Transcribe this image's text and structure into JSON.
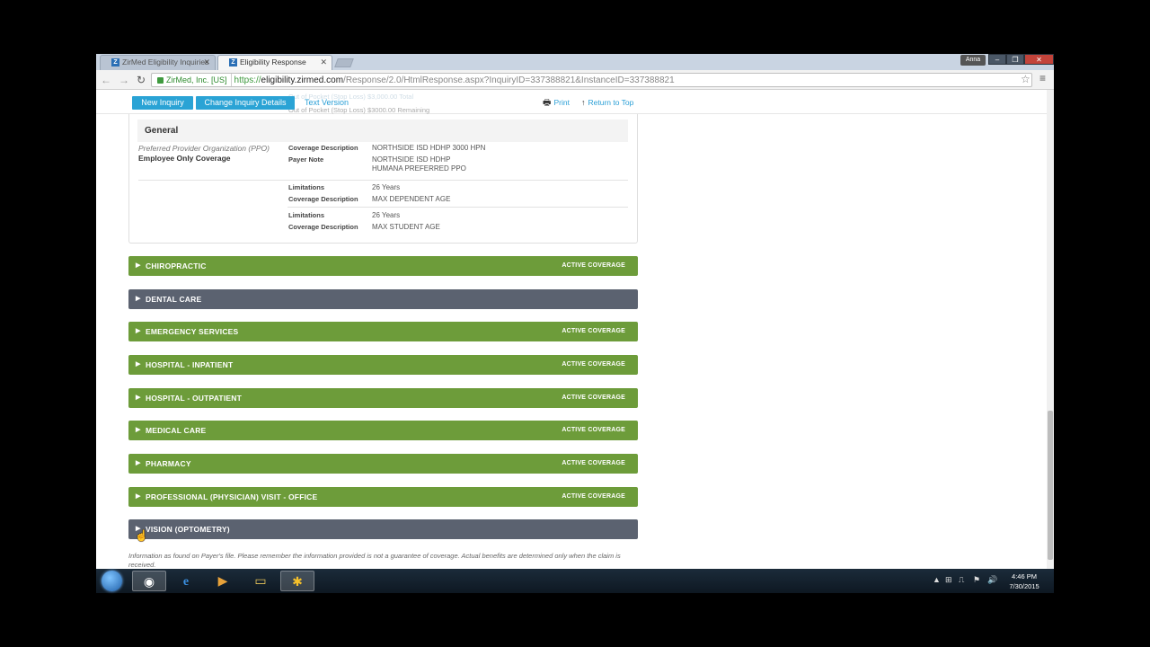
{
  "browser": {
    "tabs": [
      {
        "title": "ZirMed Eligibility Inquiries",
        "active": false
      },
      {
        "title": "Eligibility Response",
        "active": true
      }
    ],
    "user": "Anna",
    "ev_cert": "ZirMed, Inc. [US]",
    "url_scheme": "https://",
    "url_host": "eligibility.zirmed.com",
    "url_path": "/Response/2.0/HtmlResponse.aspx?InquiryID=337388821&InstanceID=337388821"
  },
  "toolbar": {
    "new_inquiry": "New Inquiry",
    "change_details": "Change Inquiry Details",
    "text_version": "Text Version",
    "print": "Print",
    "return_top": "Return to Top",
    "behind_text_1": "Out of Pocket (Stop Loss) $3,000.00 Total",
    "behind_text_2": "Out of Pocket (Stop Loss) $3000.00 Remaining"
  },
  "general": {
    "heading": "General",
    "plan_type": "Preferred Provider Organization (PPO)",
    "coverage_level": "Employee Only Coverage",
    "block1": [
      {
        "label": "Coverage Description",
        "value": "NORTHSIDE ISD HDHP 3000 HPN"
      },
      {
        "label": "Payer Note",
        "value": "NORTHSIDE ISD HDHP",
        "value2": "HUMANA PREFERRED PPO"
      }
    ],
    "block2": [
      {
        "label": "Limitations",
        "value": "26 Years"
      },
      {
        "label": "Coverage Description",
        "value": "MAX DEPENDENT AGE"
      }
    ],
    "block3": [
      {
        "label": "Limitations",
        "value": "26 Years"
      },
      {
        "label": "Coverage Description",
        "value": "MAX STUDENT AGE"
      }
    ]
  },
  "coverages": [
    {
      "name": "CHIROPRACTIC",
      "status": "ACTIVE COVERAGE",
      "color": "#6d9c3a"
    },
    {
      "name": "DENTAL CARE",
      "status": "",
      "color": "#5b6270"
    },
    {
      "name": "EMERGENCY SERVICES",
      "status": "ACTIVE COVERAGE",
      "color": "#6d9c3a"
    },
    {
      "name": "HOSPITAL - INPATIENT",
      "status": "ACTIVE COVERAGE",
      "color": "#6d9c3a"
    },
    {
      "name": "HOSPITAL - OUTPATIENT",
      "status": "ACTIVE COVERAGE",
      "color": "#6d9c3a"
    },
    {
      "name": "MEDICAL CARE",
      "status": "ACTIVE COVERAGE",
      "color": "#6d9c3a"
    },
    {
      "name": "PHARMACY",
      "status": "ACTIVE COVERAGE",
      "color": "#6d9c3a"
    },
    {
      "name": "PROFESSIONAL (PHYSICIAN) VISIT - OFFICE",
      "status": "ACTIVE COVERAGE",
      "color": "#6d9c3a"
    },
    {
      "name": "VISION (OPTOMETRY)",
      "status": "",
      "color": "#5b6270"
    }
  ],
  "disclaimer": "Information as found on Payer's file. Please remember the information provided is not a guarantee of coverage. Actual benefits are determined only when the claim is received.",
  "taskbar": {
    "time": "4:46 PM",
    "date": "7/30/2015",
    "apps": [
      "windows-start",
      "chrome-icon",
      "internet-explorer-icon",
      "media-player-icon",
      "file-explorer-icon",
      "zirmed-icon"
    ]
  }
}
